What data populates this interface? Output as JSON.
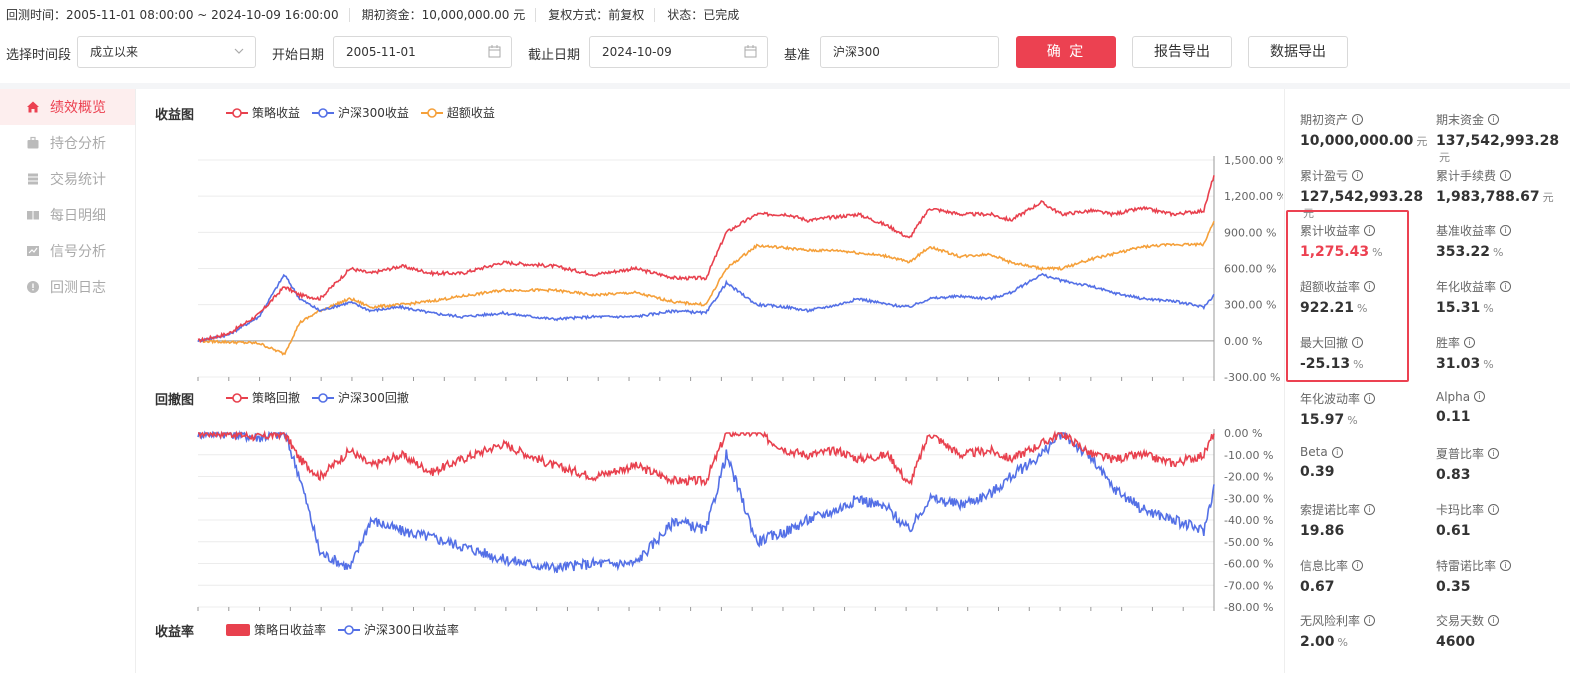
{
  "topbar": {
    "backtest_time": "回测时间：2005-11-01 08:00:00 ~ 2024-10-09 16:00:00",
    "initial_capital": "期初资金：10,000,000.00 元",
    "adjust_mode": "复权方式：前复权",
    "status": "状态：已完成"
  },
  "filters": {
    "period_label": "选择时间段",
    "period_value": "成立以来",
    "start_label": "开始日期",
    "start_value": "2005-11-01",
    "end_label": "截止日期",
    "end_value": "2024-10-09",
    "benchmark_label": "基准",
    "benchmark_value": "沪深300",
    "confirm_label": "确 定",
    "report_export_label": "报告导出",
    "data_export_label": "数据导出"
  },
  "sidebar": {
    "items": [
      {
        "label": "绩效概览",
        "icon": "home-icon",
        "active": true
      },
      {
        "label": "持仓分析",
        "icon": "briefcase-icon",
        "active": false
      },
      {
        "label": "交易统计",
        "icon": "database-icon",
        "active": false
      },
      {
        "label": "每日明细",
        "icon": "book-icon",
        "active": false
      },
      {
        "label": "信号分析",
        "icon": "line-chart-icon",
        "active": false
      },
      {
        "label": "回测日志",
        "icon": "alert-icon",
        "active": false
      }
    ]
  },
  "charts": {
    "returns_title": "收益图",
    "drawdown_title": "回撤图",
    "daily_title": "收益率",
    "returns_legend": [
      "策略收益",
      "沪深300收益",
      "超额收益"
    ],
    "drawdown_legend": [
      "策略回撤",
      "沪深300回撤"
    ],
    "daily_legend": [
      "策略日收益率",
      "沪深300日收益率"
    ]
  },
  "colors": {
    "strategy": "#e8414e",
    "benchmark": "#5470e6",
    "excess": "#f5a03a",
    "accent": "#ec4151"
  },
  "chart_data": [
    {
      "type": "line",
      "title": "收益图",
      "ylim": [
        -300,
        1500
      ],
      "yticks": [
        "1,500.00 %",
        "1,200.00 %",
        "900.00 %",
        "600.00 %",
        "300.00 %",
        "0.00 %",
        "-300.00 %"
      ],
      "x": [
        0,
        0.03,
        0.06,
        0.085,
        0.1,
        0.12,
        0.15,
        0.17,
        0.2,
        0.23,
        0.26,
        0.3,
        0.35,
        0.39,
        0.43,
        0.47,
        0.5,
        0.52,
        0.55,
        0.58,
        0.6,
        0.63,
        0.65,
        0.68,
        0.7,
        0.72,
        0.75,
        0.78,
        0.8,
        0.83,
        0.85,
        0.88,
        0.9,
        0.93,
        0.96,
        0.99,
        1.0
      ],
      "series": [
        {
          "name": "策略收益",
          "values": [
            0,
            60,
            220,
            450,
            380,
            350,
            600,
            560,
            620,
            560,
            560,
            650,
            620,
            550,
            600,
            520,
            520,
            900,
            1050,
            1050,
            1000,
            1030,
            1050,
            950,
            850,
            1100,
            1050,
            1050,
            1000,
            1150,
            1050,
            1080,
            1050,
            1100,
            1050,
            1080,
            1375
          ]
        },
        {
          "name": "沪深300收益",
          "values": [
            0,
            50,
            200,
            550,
            350,
            250,
            320,
            250,
            280,
            230,
            200,
            230,
            180,
            200,
            200,
            250,
            230,
            480,
            300,
            280,
            250,
            300,
            350,
            300,
            280,
            350,
            370,
            350,
            400,
            550,
            500,
            450,
            400,
            350,
            330,
            280,
            380
          ]
        },
        {
          "name": "超额收益",
          "values": [
            0,
            -10,
            -20,
            -110,
            150,
            250,
            350,
            280,
            300,
            330,
            370,
            420,
            420,
            380,
            400,
            320,
            300,
            600,
            790,
            770,
            750,
            750,
            730,
            700,
            650,
            780,
            700,
            720,
            650,
            600,
            600,
            680,
            720,
            780,
            800,
            800,
            1000
          ]
        }
      ]
    },
    {
      "type": "area",
      "title": "回撤图",
      "ylim": [
        -80,
        0
      ],
      "yticks": [
        "0.00 %",
        "-10.00 %",
        "-20.00 %",
        "-30.00 %",
        "-40.00 %",
        "-50.00 %",
        "-60.00 %",
        "-70.00 %",
        "-80.00 %"
      ],
      "x": [
        0,
        0.03,
        0.06,
        0.085,
        0.1,
        0.12,
        0.15,
        0.17,
        0.2,
        0.23,
        0.26,
        0.3,
        0.35,
        0.39,
        0.43,
        0.47,
        0.5,
        0.52,
        0.55,
        0.58,
        0.6,
        0.63,
        0.65,
        0.68,
        0.7,
        0.72,
        0.75,
        0.78,
        0.8,
        0.83,
        0.85,
        0.88,
        0.9,
        0.93,
        0.96,
        0.99,
        1.0
      ],
      "series": [
        {
          "name": "策略回撤",
          "values": [
            0,
            0,
            -2,
            0,
            -12,
            -20,
            -8,
            -15,
            -10,
            -18,
            -12,
            -5,
            -15,
            -20,
            -15,
            -22,
            -22,
            0,
            0,
            -8,
            -10,
            -8,
            -12,
            -10,
            -24,
            0,
            -10,
            -8,
            -12,
            -5,
            0,
            -10,
            -12,
            -10,
            -14,
            -10,
            0
          ]
        },
        {
          "name": "沪深300回撤",
          "values": [
            0,
            0,
            -2,
            0,
            -20,
            -55,
            -62,
            -40,
            -45,
            -48,
            -52,
            -58,
            -62,
            -60,
            -60,
            -40,
            -45,
            -10,
            -50,
            -45,
            -40,
            -35,
            -30,
            -35,
            -45,
            -30,
            -33,
            -28,
            -20,
            -10,
            0,
            -12,
            -25,
            -35,
            -40,
            -45,
            -25
          ]
        }
      ]
    }
  ],
  "metrics": [
    {
      "label": "期初资产",
      "value": "10,000,000.00",
      "unit": "元"
    },
    {
      "label": "期末资金",
      "value": "137,542,993.28",
      "unit": "元"
    },
    {
      "label": "累计盈亏",
      "value": "127,542,993.28",
      "unit": "元"
    },
    {
      "label": "累计手续费",
      "value": "1,983,788.67",
      "unit": "元"
    },
    {
      "label": "累计收益率",
      "value": "1,275.43",
      "unit": "%"
    },
    {
      "label": "基准收益率",
      "value": "353.22",
      "unit": "%"
    },
    {
      "label": "超额收益率",
      "value": "922.21",
      "unit": "%"
    },
    {
      "label": "年化收益率",
      "value": "15.31",
      "unit": "%"
    },
    {
      "label": "最大回撤",
      "value": "-25.13",
      "unit": "%"
    },
    {
      "label": "胜率",
      "value": "31.03",
      "unit": "%"
    },
    {
      "label": "年化波动率",
      "value": "15.97",
      "unit": "%"
    },
    {
      "label": "Alpha",
      "value": "0.11",
      "unit": ""
    },
    {
      "label": "Beta",
      "value": "0.39",
      "unit": ""
    },
    {
      "label": "夏普比率",
      "value": "0.83",
      "unit": ""
    },
    {
      "label": "索提诺比率",
      "value": "19.86",
      "unit": ""
    },
    {
      "label": "卡玛比率",
      "value": "0.61",
      "unit": ""
    },
    {
      "label": "信息比率",
      "value": "0.67",
      "unit": ""
    },
    {
      "label": "特雷诺比率",
      "value": "0.35",
      "unit": ""
    },
    {
      "label": "无风险利率",
      "value": "2.00",
      "unit": "%"
    },
    {
      "label": "交易天数",
      "value": "4600",
      "unit": ""
    }
  ]
}
